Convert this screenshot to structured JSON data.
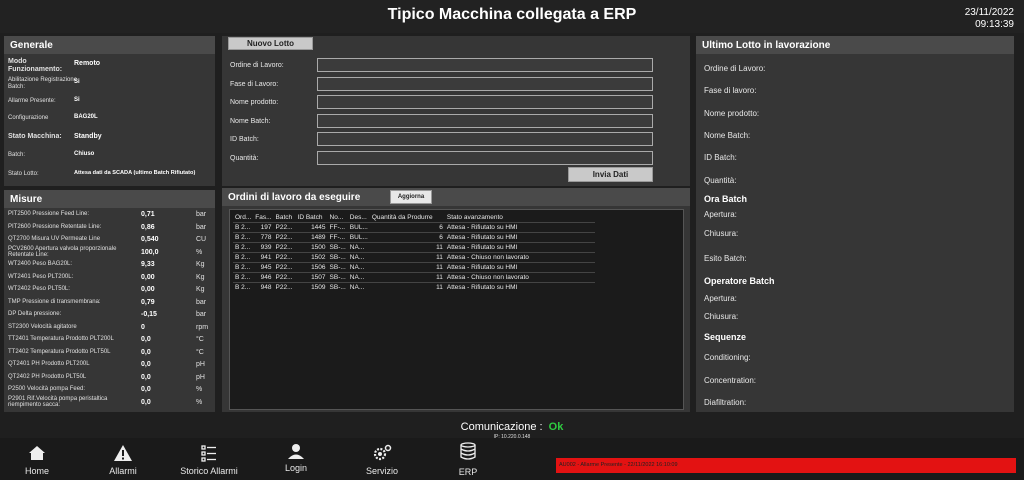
{
  "header": {
    "title": "Tipico Macchina collegata a ERP",
    "date": "23/11/2022",
    "time": "09:13:39"
  },
  "generale": {
    "title": "Generale",
    "modo_label": "Modo Funzionamento:",
    "modo_value": "Remoto",
    "abil_label": "Abilitazione Registrazione Batch:",
    "abil_value": "Si",
    "allarme_label": "Allarme Presente:",
    "allarme_value": "Si",
    "config_label": "Configurazione",
    "config_value": "BAG20L",
    "stato_label": "Stato Macchina:",
    "stato_value": "Standby",
    "batch_label": "Batch:",
    "batch_value": "Chiuso",
    "statolotto_label": "Stato Lotto:",
    "statolotto_value": "Attesa dati da SCADA (ultimo Batch Rifiutato)"
  },
  "misure": {
    "title": "Misure",
    "rows": [
      {
        "label": "PIT2500 Pressione Feed Line:",
        "value": "0,71",
        "unit": "bar"
      },
      {
        "label": "PIT2600 Pressione Retentate Line:",
        "value": "0,86",
        "unit": "bar"
      },
      {
        "label": "QT2700 Misura UV Permeate Line",
        "value": "0,540",
        "unit": "CU"
      },
      {
        "label": "PCV2600 Apertura valvola proporzionale Retentate Line:",
        "value": "100,0",
        "unit": "%"
      },
      {
        "label": "WT2400 Peso BAG20L:",
        "value": "9,33",
        "unit": "Kg"
      },
      {
        "label": "WT2401 Peso PLT200L:",
        "value": "0,00",
        "unit": "Kg"
      },
      {
        "label": "WT2402 Peso PLT50L:",
        "value": "0,00",
        "unit": "Kg"
      },
      {
        "label": "TMP Pressione di transmembrana:",
        "value": "0,79",
        "unit": "bar"
      },
      {
        "label": "DP Delta pressione:",
        "value": "-0,15",
        "unit": "bar"
      },
      {
        "label": "ST2300 Velocità agitatore",
        "value": "0",
        "unit": "rpm"
      },
      {
        "label": "TT2401 Temperatura Prodotto PLT200L",
        "value": "0,0",
        "unit": "°C"
      },
      {
        "label": "TT2402 Temperatura Prodotto PLT50L",
        "value": "0,0",
        "unit": "°C"
      },
      {
        "label": "QT2401 PH Prodotto PLT200L",
        "value": "0,0",
        "unit": "pH"
      },
      {
        "label": "QT2402 PH Prodotto PLT50L",
        "value": "0,0",
        "unit": "pH"
      },
      {
        "label": "P2500 Velocità pompa Feed:",
        "value": "0,0",
        "unit": "%"
      },
      {
        "label": "P2901 Rif.Velocità pompa peristaltica riempimento sacca:",
        "value": "0,0",
        "unit": "%"
      }
    ]
  },
  "nuovo_lotto": {
    "button": "Nuovo Lotto",
    "fields": [
      "Ordine di Lavoro:",
      "Fase di Lavoro:",
      "Nome prodotto:",
      "Nome Batch:",
      "ID Batch:",
      "Quantità:"
    ],
    "invia": "Invia Dati"
  },
  "ordini": {
    "title": "Ordini di lavoro da eseguire",
    "aggiorna": "Aggiorna",
    "columns": [
      "Ord...",
      "Fas...",
      "Batch",
      "ID Batch",
      "No...",
      "Des...",
      "Quantità da Produrre",
      "Stato avanzamento"
    ],
    "rows": [
      [
        "B 2...",
        "197",
        "P22...",
        "1445",
        "FF-...",
        "BUL...",
        "6",
        "Attesa - Rifiutato su HMI"
      ],
      [
        "B 2...",
        "778",
        "P22...",
        "1489",
        "FF-...",
        "BUL...",
        "6",
        "Attesa - Rifiutato su HMI"
      ],
      [
        "B 2...",
        "939",
        "P22...",
        "1500",
        "SB-...",
        "NA...",
        "11",
        "Attesa - Rifiutato su HMI"
      ],
      [
        "B 2...",
        "941",
        "P22...",
        "1502",
        "SB-...",
        "NA...",
        "11",
        "Attesa - Chiuso non lavorato"
      ],
      [
        "B 2...",
        "945",
        "P22...",
        "1506",
        "SB-...",
        "NA...",
        "11",
        "Attesa - Rifiutato su HMI"
      ],
      [
        "B 2...",
        "946",
        "P22...",
        "1507",
        "SB-...",
        "NA...",
        "11",
        "Attesa - Chiuso non lavorato"
      ],
      [
        "B 2...",
        "948",
        "P22...",
        "1509",
        "SB-...",
        "NA...",
        "11",
        "Attesa - Rifiutato su HMI"
      ]
    ]
  },
  "ultimo": {
    "title": "Ultimo Lotto in lavorazione",
    "fields": [
      "Ordine di Lavoro:",
      "Fase di lavoro:",
      "Nome prodotto:",
      "Nome Batch:",
      "ID Batch:",
      "Quantità:"
    ],
    "ora_title": "Ora Batch",
    "apertura": "Apertura:",
    "chiusura": "Chiusura:",
    "esito": "Esito Batch:",
    "op_title": "Operatore Batch",
    "op_apertura": "Apertura:",
    "op_chiusura": "Chiusura:",
    "seq_title": "Sequenze",
    "seq": [
      "Conditioning:",
      "Concentration:",
      "Diafiltration:"
    ]
  },
  "comunicazione": {
    "label": "Comunicazione :",
    "status": "Ok",
    "ip": "IP: 10.220.0.148"
  },
  "nav": [
    "Home",
    "Allarmi",
    "Storico Allarmi",
    "Login",
    "Servizio",
    "ERP"
  ],
  "alarm_text": "AU002 - Allarme Presente - 22/11/2022 16:10:09",
  "colors": {
    "ok": "#2ecc40",
    "alarm": "#e31212"
  }
}
